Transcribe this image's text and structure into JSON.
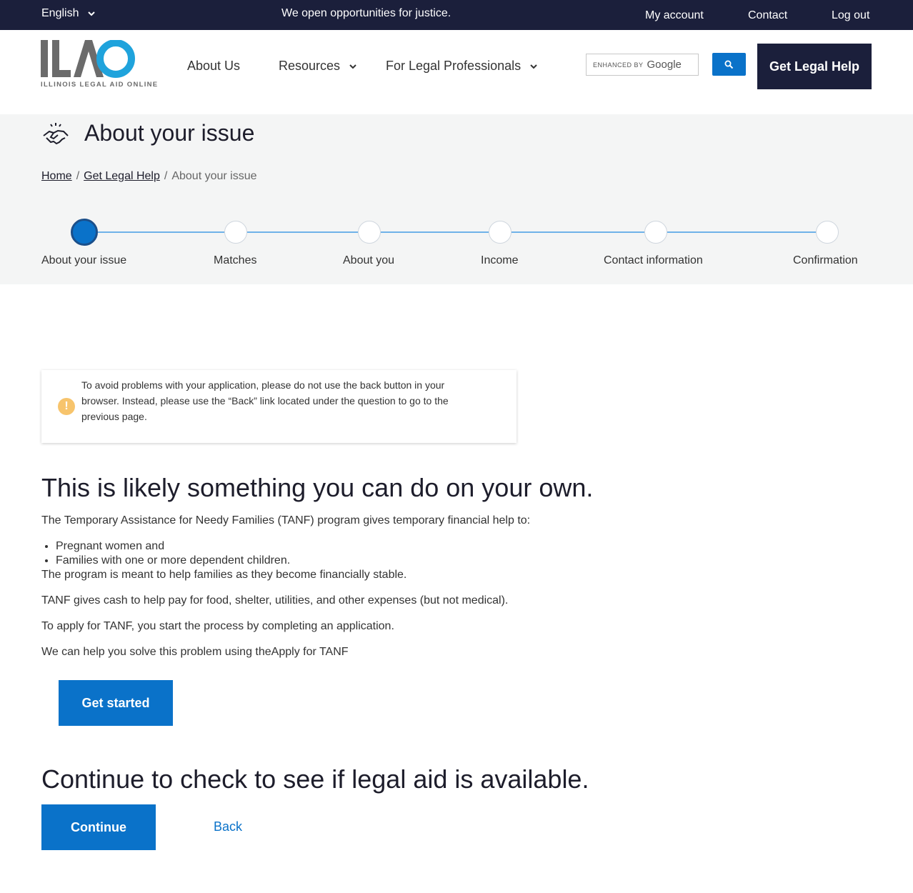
{
  "topbar": {
    "language": "English",
    "tagline": "We open opportunities for justice.",
    "my_account": "My account",
    "contact": "Contact",
    "logout": "Log out"
  },
  "header": {
    "logo_text": "ILAO",
    "logo_subtitle": "ILLINOIS LEGAL AID ONLINE",
    "nav": {
      "about": "About Us",
      "resources": "Resources",
      "professionals": "For Legal Professionals"
    },
    "search": {
      "enhanced_by": "ENHANCED BY",
      "google": "Google"
    },
    "cta": "Get Legal Help"
  },
  "page": {
    "title": "About your issue",
    "breadcrumb": {
      "home": "Home",
      "get_legal_help": "Get Legal Help",
      "current": "About your issue"
    }
  },
  "stepper": {
    "steps": [
      {
        "label": "About your issue",
        "active": true
      },
      {
        "label": "Matches",
        "active": false
      },
      {
        "label": "About you",
        "active": false
      },
      {
        "label": "Income",
        "active": false
      },
      {
        "label": "Contact information",
        "active": false
      },
      {
        "label": "Confirmation",
        "active": false
      }
    ]
  },
  "notice": {
    "text": "To avoid problems with your application, please do not use the back button in your browser. Instead, please use the “Back” link located under the question to go to the previous page."
  },
  "content": {
    "heading": "This is likely something you can do on your own.",
    "intro": "The Temporary Assistance for Needy Families (TANF) program gives temporary financial help to:",
    "bullets": [
      "Pregnant women and",
      "Families with one or more dependent children."
    ],
    "p1": "The program is meant to help families as they become financially stable.",
    "p2": "TANF gives cash to help pay for food, shelter, utilities, and other expenses (but not medical).",
    "p3": "To apply for TANF, you start the process by completing an application.",
    "p4": "We can help you solve this problem using theApply for TANF",
    "get_started": "Get started",
    "heading2": "Continue to check to see if legal aid is available.",
    "continue": "Continue",
    "back": "Back"
  },
  "colors": {
    "navy": "#1b1f3b",
    "blue": "#0a72c9",
    "warning": "#f7c46c"
  }
}
